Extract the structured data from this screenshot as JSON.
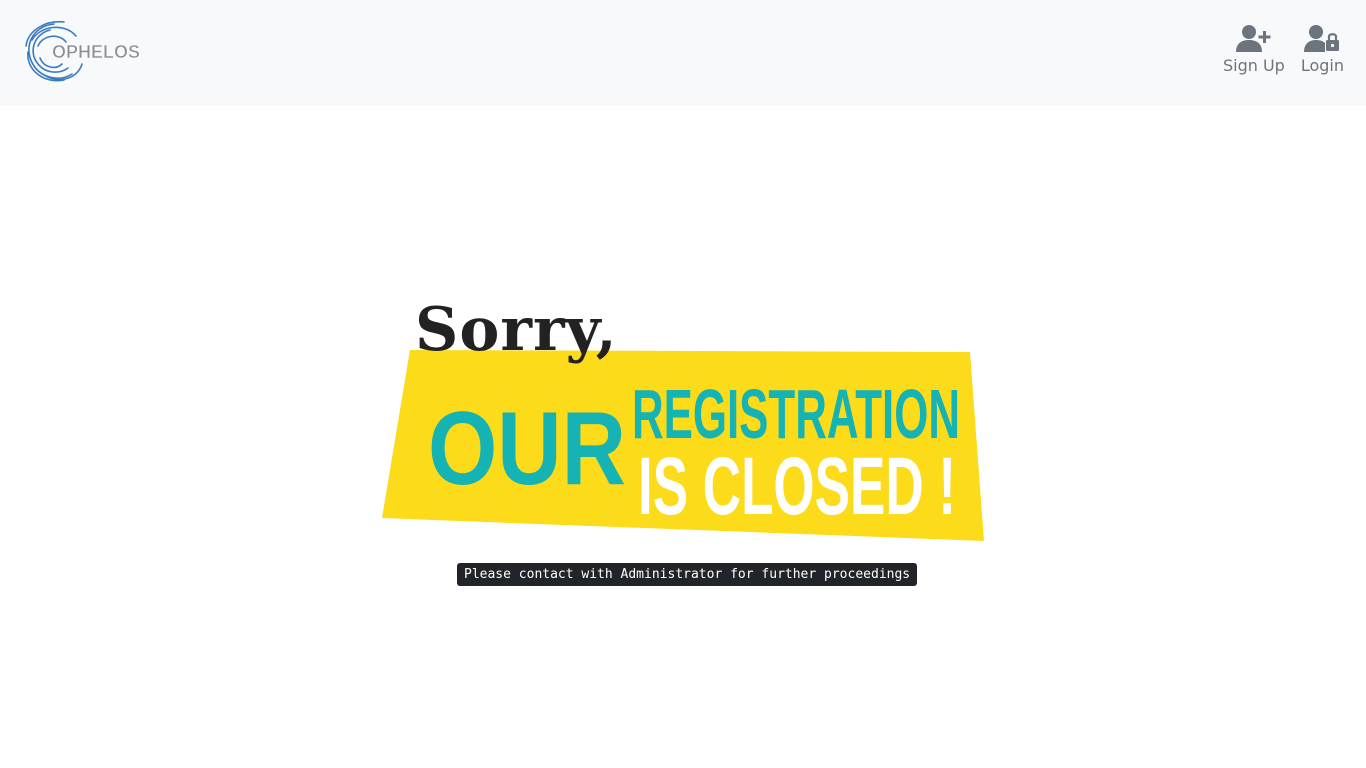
{
  "brand": {
    "logo_text": "OPHELOS",
    "logo_colors": {
      "swirl": "#3b7bbf",
      "text": "#8a8f94"
    }
  },
  "nav": {
    "signup": {
      "label": "Sign Up",
      "icon": "user-plus-icon"
    },
    "login": {
      "label": "Login",
      "icon": "user-lock-icon"
    }
  },
  "banner": {
    "sorry": "Sorry,",
    "our": "OUR",
    "registration": "REGISTRATION",
    "is_closed": "IS CLOSED !",
    "colors": {
      "background": "#fcdb1a",
      "teal": "#15b3b3",
      "white": "#ffffff",
      "sorry": "#222222"
    }
  },
  "notice": {
    "text": "Please contact with Administrator for further proceedings"
  }
}
